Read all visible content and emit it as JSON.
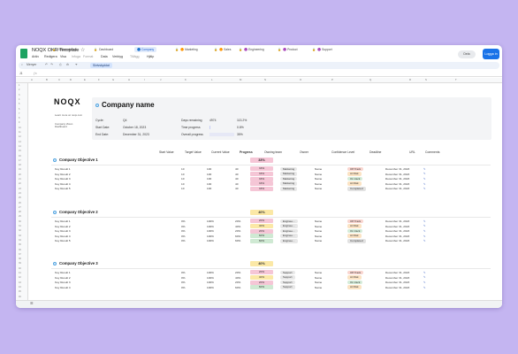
{
  "app": {
    "title": "NOQX OKR Template",
    "menu": [
      "Arkiv",
      "Redigera",
      "Visa",
      "Infoga",
      "Format",
      "Data",
      "Verktyg",
      "Tillägg",
      "Hjälp"
    ],
    "share_label": "Dela",
    "login_label": "Logga in",
    "toolbar": {
      "search_label": "Menyer",
      "zoom_label": "Skrivskyddat"
    },
    "cell_ref": "J1"
  },
  "columns": [
    "A",
    "B",
    "C",
    "D",
    "E",
    "F",
    "G",
    "H",
    "I",
    "J",
    "K",
    "L",
    "M",
    "N",
    "O",
    "P",
    "Q",
    "R",
    "S",
    "T"
  ],
  "logo": {
    "text": "NOQX",
    "link_text": "Learn more on noqx.com",
    "vision_label": "Company Vision Dashboard"
  },
  "company": {
    "name": "Company name",
    "cycle_label": "Cycle:",
    "cycle_value": "Q4",
    "start_label": "Start Date:",
    "start_value": "October 18, 2023",
    "end_label": "End Date:",
    "end_value": "December 31, 2023",
    "days_label": "Days remaining",
    "days_value": "4974",
    "days_pct": "113.2%",
    "time_label": "Time progress",
    "time_pct": "0.8%",
    "time_fraction": 0.02,
    "overall_label": "Overall progress",
    "overall_pct": "35%",
    "overall_fraction": 0.35
  },
  "headers": {
    "start": "Start Value",
    "target": "Target Value",
    "current": "Current Value",
    "progress": "Progress",
    "team": "Owning team",
    "owner": "Owner",
    "confidence": "Confidence Level",
    "deadline": "Deadline",
    "url": "URL",
    "comments": "Comments"
  },
  "objectives": [
    {
      "title": "Company Objective 1",
      "progress": "33%",
      "color": "#f5c6d6",
      "krs": [
        {
          "name": "Key Result 1",
          "start": "10",
          "target": "100",
          "current": "40",
          "progress": "33%",
          "team": "Marketing",
          "owner": "Name",
          "confidence": "Off Track",
          "deadline": "December 31, 2023"
        },
        {
          "name": "Key Result 2",
          "start": "10",
          "target": "100",
          "current": "40",
          "progress": "33%",
          "team": "Marketing",
          "owner": "Name",
          "confidence": "At Risk",
          "deadline": "December 31, 2023"
        },
        {
          "name": "Key Result 3",
          "start": "10",
          "target": "100",
          "current": "40",
          "progress": "33%",
          "team": "Marketing",
          "owner": "Name",
          "confidence": "On track",
          "deadline": "December 31, 2023"
        },
        {
          "name": "Key Result 4",
          "start": "10",
          "target": "100",
          "current": "40",
          "progress": "33%",
          "team": "Marketing",
          "owner": "Name",
          "confidence": "At Risk",
          "deadline": "December 31, 2023"
        },
        {
          "name": "Key Result 5",
          "start": "10",
          "target": "100",
          "current": "40",
          "progress": "33%",
          "team": "Marketing",
          "owner": "Name",
          "confidence": "Completed",
          "deadline": "December 31, 2023"
        }
      ]
    },
    {
      "title": "Company Objective 2",
      "progress": "40%",
      "color": "#fbe8a6",
      "krs": [
        {
          "name": "Key Result 1",
          "start": "0%",
          "target": "100%",
          "current": "20%",
          "progress": "20%",
          "team": "Enginee...",
          "owner": "Name",
          "confidence": "Off Track",
          "deadline": "December 31, 2023"
        },
        {
          "name": "Key Result 2",
          "start": "0%",
          "target": "100%",
          "current": "40%",
          "progress": "40%",
          "team": "Enginee...",
          "owner": "Name",
          "confidence": "At Risk",
          "deadline": "December 31, 2023"
        },
        {
          "name": "Key Result 3",
          "start": "0%",
          "target": "100%",
          "current": "20%",
          "progress": "20%",
          "team": "Enginee...",
          "owner": "Name",
          "confidence": "On track",
          "deadline": "December 31, 2023"
        },
        {
          "name": "Key Result 4",
          "start": "0%",
          "target": "100%",
          "current": "60%",
          "progress": "60%",
          "team": "Enginee...",
          "owner": "Name",
          "confidence": "At Risk",
          "deadline": "December 31, 2023"
        },
        {
          "name": "Key Result 5",
          "start": "0%",
          "target": "100%",
          "current": "60%",
          "progress": "60%",
          "team": "Enginee...",
          "owner": "Name",
          "confidence": "Completed",
          "deadline": "December 31, 2023"
        }
      ]
    },
    {
      "title": "Company Objective 3",
      "progress": "40%",
      "color": "#fbe8a6",
      "krs": [
        {
          "name": "Key Result 1",
          "start": "0%",
          "target": "100%",
          "current": "20%",
          "progress": "20%",
          "team": "Support",
          "owner": "Name",
          "confidence": "Off Track",
          "deadline": "December 31, 2023"
        },
        {
          "name": "Key Result 2",
          "start": "0%",
          "target": "100%",
          "current": "40%",
          "progress": "40%",
          "team": "Support",
          "owner": "Name",
          "confidence": "At Risk",
          "deadline": "December 31, 2023"
        },
        {
          "name": "Key Result 3",
          "start": "0%",
          "target": "100%",
          "current": "20%",
          "progress": "20%",
          "team": "Support",
          "owner": "Name",
          "confidence": "On track",
          "deadline": "December 31, 2023"
        },
        {
          "name": "Key Result 4",
          "start": "0%",
          "target": "100%",
          "current": "60%",
          "progress": "60%",
          "team": "Support",
          "owner": "Name",
          "confidence": "At Risk",
          "deadline": "December 31, 2023"
        }
      ]
    }
  ],
  "progress_colors": {
    "low": "#f5c6d6",
    "mid": "#fbe8a6",
    "high": "#cfe9d3"
  },
  "confidence_colors": {
    "Off Track": "#f9d5cf",
    "At Risk": "#fbe3c4",
    "On track": "#d5ecd9",
    "Completed": "#e2e2e2"
  },
  "tabs": [
    {
      "label": "Getting started",
      "icon": "lock-icon",
      "active": false
    },
    {
      "label": "Dashboard",
      "icon": "lock-icon",
      "active": false
    },
    {
      "label": "🔵 Company",
      "icon": "",
      "active": true
    },
    {
      "label": "🟠 Marketing",
      "icon": "lock-icon",
      "active": false
    },
    {
      "label": "🟠 Sales",
      "icon": "lock-icon",
      "active": false
    },
    {
      "label": "🟣 Engineering",
      "icon": "lock-icon",
      "active": false
    },
    {
      "label": "🟣 Product",
      "icon": "lock-icon",
      "active": false
    },
    {
      "label": "🟣 Support",
      "icon": "lock-icon",
      "active": false
    }
  ]
}
